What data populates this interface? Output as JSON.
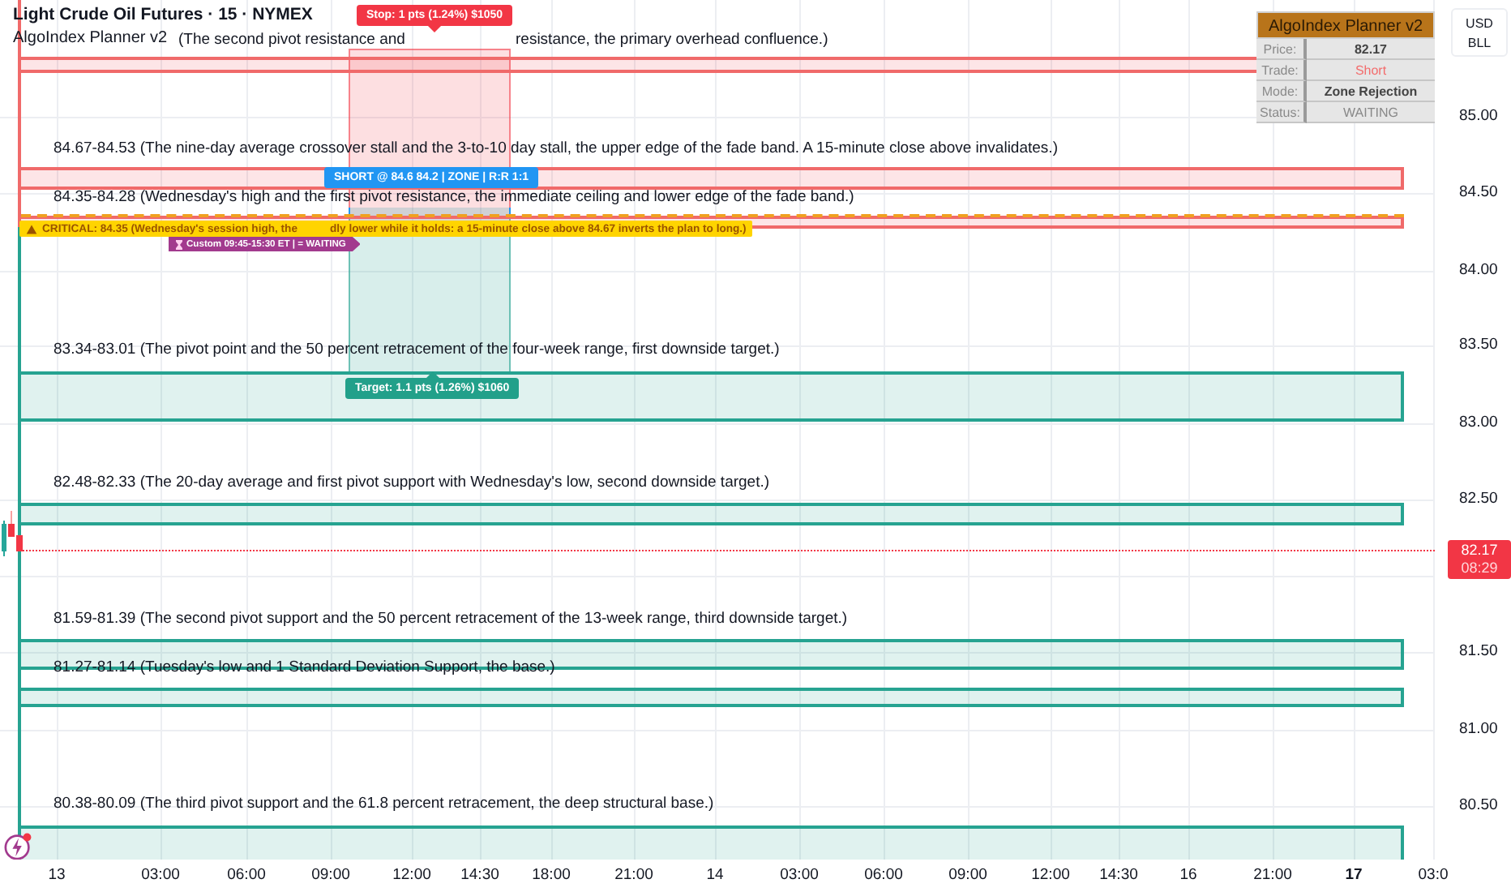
{
  "header": {
    "title": "Light Crude Oil Futures · 15 · NYMEX",
    "indicator": "AlgoIndex Planner v2"
  },
  "zones": [
    {
      "kind": "resistance",
      "label": "(The second pivot resistance and",
      "label_tail": "resistance, the primary overhead confluence.)"
    },
    {
      "kind": "resistance",
      "label": "84.67-84.53 (The nine-day average crossover stall and the 3-to-10 day stall, the upper edge of the fade band. A 15-minute close above invalidates.)"
    },
    {
      "kind": "resistance",
      "label": "84.35-84.28 (Wednesday's high and the first pivot resistance, the immediate ceiling and lower edge of the fade band.)"
    },
    {
      "kind": "support",
      "label": "83.34-83.01 (The pivot point and the 50 percent retracement of the four-week range, first downside target.)"
    },
    {
      "kind": "support",
      "label": "82.48-82.33 (The 20-day average and first pivot support with Wednesday's low, second downside target.)"
    },
    {
      "kind": "support",
      "label": "81.59-81.39 (The second pivot support and the 50 percent retracement of the 13-week range, third downside target.)"
    },
    {
      "kind": "support",
      "label": "81.27-81.14 (Tuesday's low and 1 Standard Deviation Support, the base.)"
    },
    {
      "kind": "support",
      "label": "80.38-80.09 (The third pivot support and the 61.8 percent retracement, the deep structural base.)"
    }
  ],
  "position": {
    "stop_label": "Stop: 1 pts (1.24%) $1050",
    "entry_label": "SHORT @ 84.6 84.2 | ZONE | R:R 1:1",
    "target_label": "Target: 1.1 pts (1.26%) $1060"
  },
  "critical": {
    "text_start": "CRITICAL: 84.35 (Wednesday's session high, the",
    "text_end": "dly lower while it holds: a 15-minute close above 84.67 inverts the plan to long.)"
  },
  "session": {
    "label": "Custom 09:45-15:30 ET | = WAITING"
  },
  "panel": {
    "title": "AlgoIndex Planner v2",
    "rows": [
      {
        "label": "Price:",
        "value": "82.17",
        "kind": "plain"
      },
      {
        "label": "Trade:",
        "value": "Short",
        "kind": "short"
      },
      {
        "label": "Mode:",
        "value": "Zone Rejection",
        "kind": "plain"
      },
      {
        "label": "Status:",
        "value": "WAITING",
        "kind": "muted"
      }
    ]
  },
  "price_axis": {
    "currency": "USD",
    "unit": "BLL",
    "ticks": [
      "85.00",
      "84.50",
      "84.00",
      "83.50",
      "83.00",
      "82.50",
      "81.50",
      "81.00",
      "80.50"
    ],
    "current_price": "82.17",
    "countdown": "08:29"
  },
  "time_axis": [
    {
      "label": "13",
      "bold": false
    },
    {
      "label": "03:00",
      "bold": false
    },
    {
      "label": "06:00",
      "bold": false
    },
    {
      "label": "09:00",
      "bold": false
    },
    {
      "label": "12:00",
      "bold": false
    },
    {
      "label": "14:30",
      "bold": false
    },
    {
      "label": "18:00",
      "bold": false
    },
    {
      "label": "21:00",
      "bold": false
    },
    {
      "label": "14",
      "bold": false
    },
    {
      "label": "03:00",
      "bold": false
    },
    {
      "label": "06:00",
      "bold": false
    },
    {
      "label": "09:00",
      "bold": false
    },
    {
      "label": "12:00",
      "bold": false
    },
    {
      "label": "14:30",
      "bold": false
    },
    {
      "label": "16",
      "bold": false
    },
    {
      "label": "21:00",
      "bold": false
    },
    {
      "label": "17",
      "bold": true
    },
    {
      "label": "03:0",
      "bold": false
    }
  ]
}
